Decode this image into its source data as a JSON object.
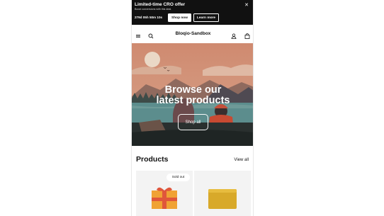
{
  "announcement": {
    "title": "Limited-time CRO offer",
    "subtitle": "Boost conversions with this deal.",
    "countdown": "279d 05h 50m 10s",
    "shop_now_label": "Shop now",
    "learn_more_label": "Learn more",
    "close_glyph": "✕",
    "background_color": "#111111"
  },
  "header": {
    "store_name": "Bloqio-Sandbox",
    "icons": [
      "menu-icon",
      "search-icon",
      "account-icon",
      "cart-icon"
    ]
  },
  "hero": {
    "title_line1": "Browse our",
    "title_line2": "latest products",
    "button_label": "Shop all"
  },
  "products": {
    "title": "Products",
    "view_all_label": "View all",
    "items": [
      {
        "badge": "Sold out",
        "image": "gift-box-image"
      },
      {
        "badge": "",
        "image": "soap-bar-image"
      }
    ]
  }
}
